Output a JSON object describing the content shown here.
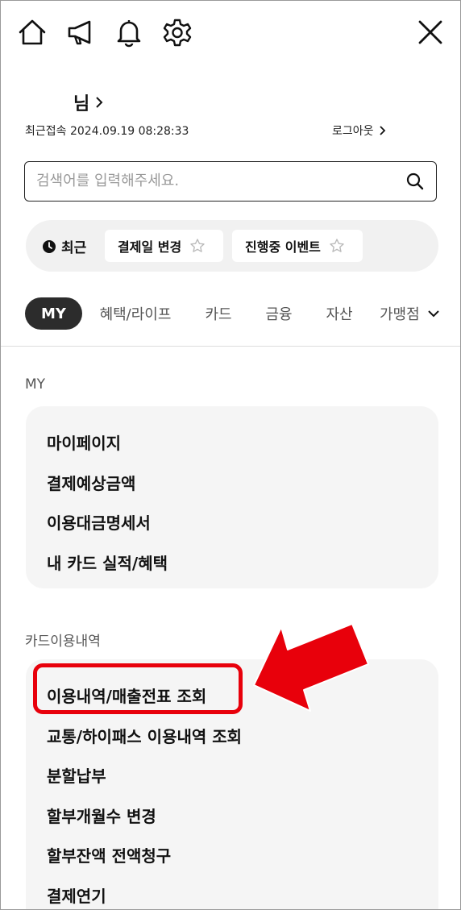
{
  "topbar": {
    "icons": [
      "home-icon",
      "megaphone-icon",
      "bell-icon",
      "gear-icon",
      "close-icon"
    ]
  },
  "user": {
    "name_suffix": "님",
    "last_login": "최근접속 2024.09.19 08:28:33",
    "logout_label": "로그아웃"
  },
  "search": {
    "placeholder": "검색어를 입력해주세요."
  },
  "recent": {
    "label": "최근",
    "chips": [
      "결제일 변경",
      "진행중 이벤트"
    ]
  },
  "tabs": [
    "MY",
    "혜택/라이프",
    "카드",
    "금융",
    "자산",
    "가맹점"
  ],
  "sections": [
    {
      "title": "MY",
      "items": [
        "마이페이지",
        "결제예상금액",
        "이용대금명세서",
        "내 카드 실적/혜택"
      ]
    },
    {
      "title": "카드이용내역",
      "items": [
        "이용내역/매출전표 조회",
        "교통/하이패스 이용내역 조회",
        "분할납부",
        "할부개월수 변경",
        "할부잔액 전액청구",
        "결제연기"
      ]
    }
  ],
  "colors": {
    "highlight": "#e8000b",
    "active_tab_bg": "#2c2c2c",
    "card_bg": "#f5f5f5"
  }
}
